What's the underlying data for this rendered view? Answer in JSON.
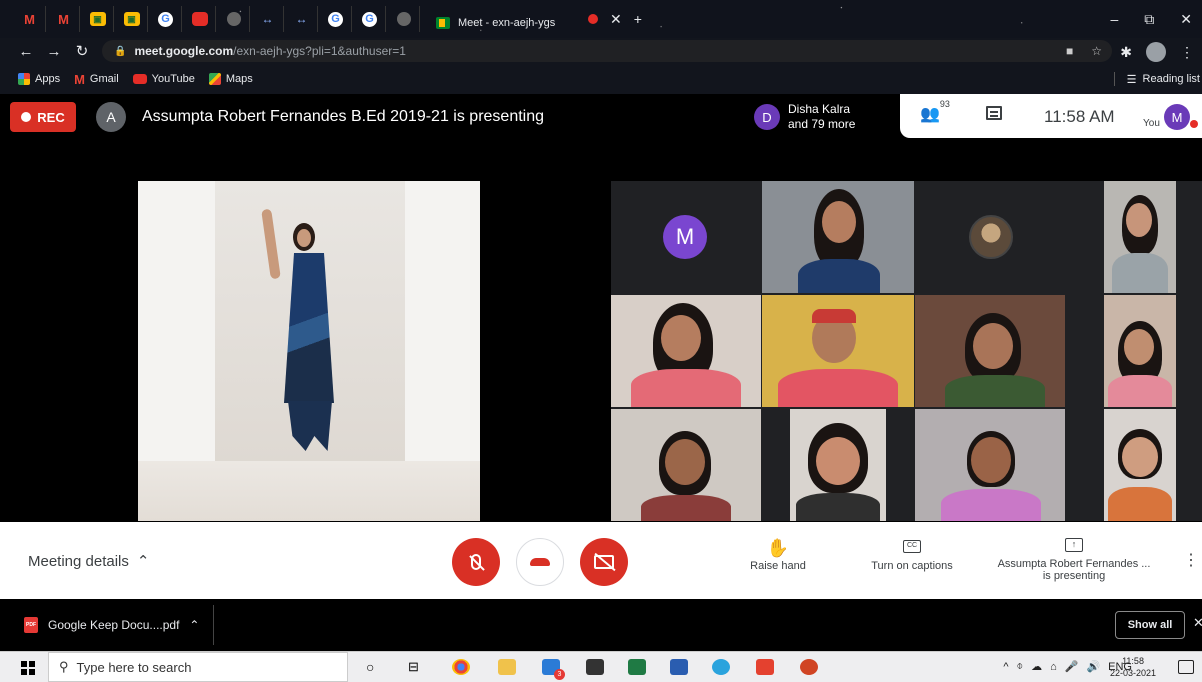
{
  "browser": {
    "active_tab_title": "Meet - exn-aejh-ygs",
    "url_domain": "meet.google.com",
    "url_path": "/exn-aejh-ygs?pli=1&authuser=1",
    "bookmarks": [
      "Apps",
      "Gmail",
      "YouTube",
      "Maps"
    ],
    "reading_list": "Reading list"
  },
  "meeting": {
    "rec_label": "REC",
    "presenter_initial": "A",
    "presenting_text": "Assumpta Robert Fernandes B.Ed 2019-21 is presenting",
    "joiner_initial": "D",
    "joiner_name": "Disha Kalra",
    "joiner_more": "and 79 more",
    "participant_count": "93",
    "time": "11:58 AM",
    "you_label": "You",
    "self_initial": "M",
    "tile_avatar_initial": "M"
  },
  "controls": {
    "meeting_details": "Meeting details",
    "raise_hand": "Raise hand",
    "captions": "Turn on captions",
    "presenting_line1": "Assumpta Robert Fernandes ...",
    "presenting_line2": "is presenting"
  },
  "downloads": {
    "file_name": "Google Keep Docu....pdf",
    "show_all": "Show all"
  },
  "taskbar": {
    "search_placeholder": "Type here to search",
    "lang": "ENG",
    "time": "11:58",
    "date": "22-03-2021",
    "notification_count": "3"
  },
  "colors": {
    "rec_red": "#d93025",
    "avatar_purple": "#6a3ab8"
  }
}
